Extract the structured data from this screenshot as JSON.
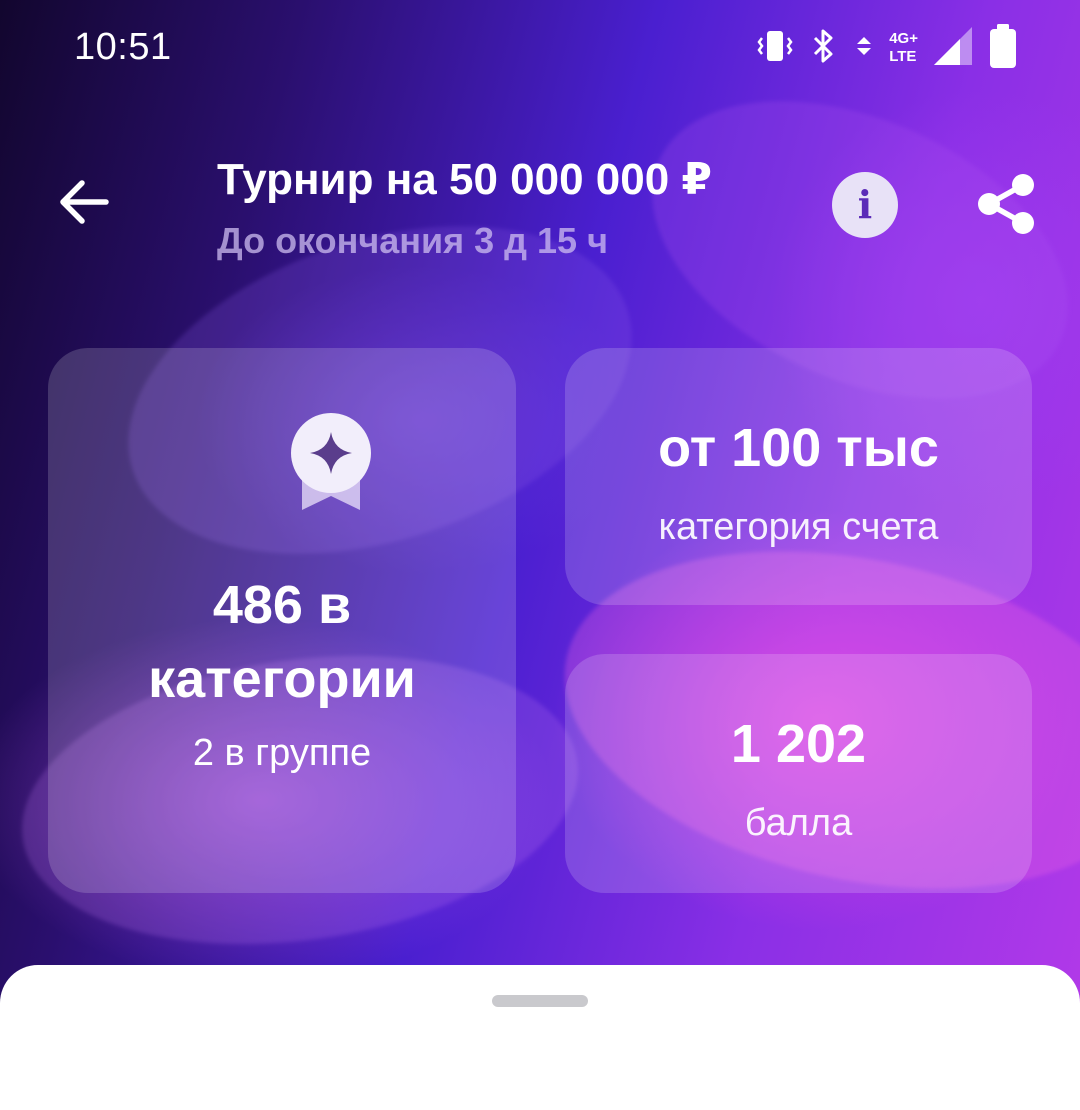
{
  "status_bar": {
    "time": "10:51",
    "network_top": "4G+",
    "network_bottom": "LTE",
    "icons": [
      "vibrate-icon",
      "bluetooth-icon",
      "data-arrows-icon",
      "signal-icon",
      "battery-icon"
    ]
  },
  "header": {
    "title": "Турнир на 50 000 000 ₽",
    "subtitle": "До окончания 3 д 15 ч",
    "info_glyph": "i",
    "icons": [
      "back-arrow-icon",
      "info-icon",
      "share-icon"
    ]
  },
  "cards": {
    "rank": {
      "line1": "486 в",
      "line2": "категории",
      "group": "2 в группе",
      "icon": "medal-icon"
    },
    "category": {
      "value": "от 100 тыс",
      "label": "категория счета"
    },
    "points": {
      "value": "1 202",
      "label": "балла"
    }
  },
  "colors": {
    "background_dark": "#12062e",
    "background_violet": "#4a1fd0",
    "background_pink": "#b43ae8",
    "info_button": "#e8e2f7",
    "info_glyph": "#5b2bb8",
    "card_tint": "rgba(255,255,255,0.17)",
    "sheet": "#ffffff",
    "sheet_handle": "#c9c9cd"
  }
}
